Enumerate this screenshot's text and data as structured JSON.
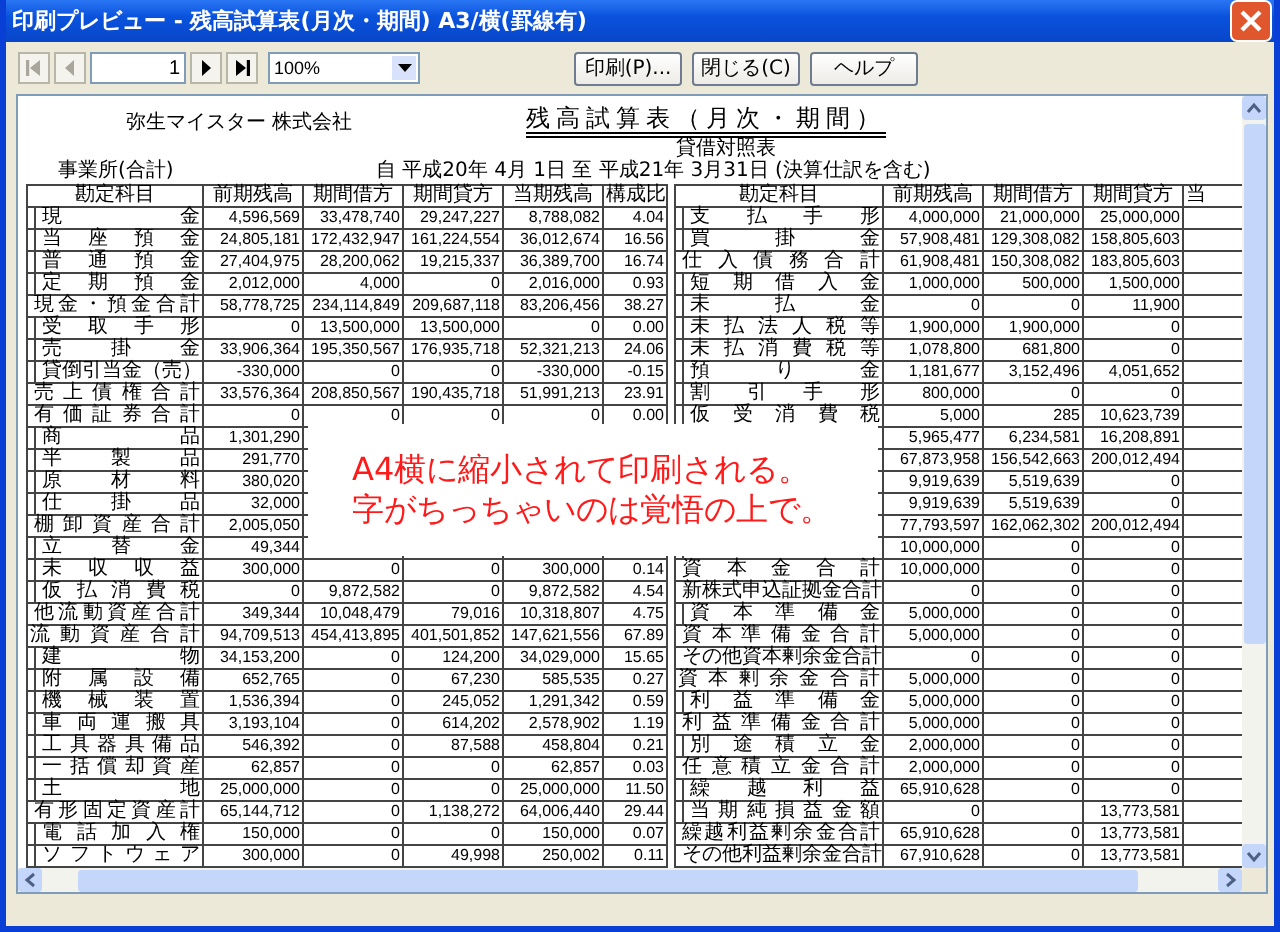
{
  "window": {
    "title": "印刷プレビュー - 残高試算表(月次・期間) A3/横(罫線有)"
  },
  "toolbar": {
    "nav": [
      {
        "kind": "first",
        "disabled": true
      },
      {
        "kind": "prev",
        "disabled": true
      },
      {
        "kind": "next",
        "disabled": false
      },
      {
        "kind": "last",
        "disabled": false
      }
    ],
    "page": "1",
    "zoom": "100%",
    "buttons": [
      "印刷(P)...",
      "閉じる(C)",
      "ヘルプ"
    ]
  },
  "report": {
    "company": "弥生マイスター 株式会社",
    "title": "残高試算表（月次・期間）",
    "statement": "貸借対照表",
    "division": "事業所(合計)",
    "period": "自 平成20年 4月 1日 至 平成21年 3月31日 (決算仕訳を含む)",
    "left_table": {
      "columns": [
        "勘定科目",
        "前期残高",
        "期間借方",
        "期間貸方",
        "当期残高",
        "構成比"
      ],
      "rows": [
        {
          "kind": "item",
          "label": "現金",
          "opening": "4,596,569",
          "debit": "33,478,740",
          "credit": "29,247,227",
          "balance": "8,788,082",
          "ratio": "4.04"
        },
        {
          "kind": "item",
          "label": "当座預金",
          "opening": "24,805,181",
          "debit": "172,432,947",
          "credit": "161,224,554",
          "balance": "36,012,674",
          "ratio": "16.56"
        },
        {
          "kind": "item",
          "label": "普通預金",
          "opening": "27,404,975",
          "debit": "28,200,062",
          "credit": "19,215,337",
          "balance": "36,389,700",
          "ratio": "16.74"
        },
        {
          "kind": "item",
          "label": "定期預金",
          "opening": "2,012,000",
          "debit": "4,000",
          "credit": "0",
          "balance": "2,016,000",
          "ratio": "0.93"
        },
        {
          "kind": "total",
          "label": "現金・預金合計",
          "opening": "58,778,725",
          "debit": "234,114,849",
          "credit": "209,687,118",
          "balance": "83,206,456",
          "ratio": "38.27"
        },
        {
          "kind": "item",
          "label": "受取手形",
          "opening": "0",
          "debit": "13,500,000",
          "credit": "13,500,000",
          "balance": "0",
          "ratio": "0.00"
        },
        {
          "kind": "item",
          "label": "売掛金",
          "opening": "33,906,364",
          "debit": "195,350,567",
          "credit": "176,935,718",
          "balance": "52,321,213",
          "ratio": "24.06"
        },
        {
          "kind": "item",
          "label": "貸倒引当金（売）",
          "opening": "-330,000",
          "debit": "0",
          "credit": "0",
          "balance": "-330,000",
          "ratio": "-0.15"
        },
        {
          "kind": "total",
          "label": "売上債権合計",
          "opening": "33,576,364",
          "debit": "208,850,567",
          "credit": "190,435,718",
          "balance": "51,991,213",
          "ratio": "23.91"
        },
        {
          "kind": "total",
          "label": "有価証券合計",
          "opening": "0",
          "debit": "0",
          "credit": "0",
          "balance": "0",
          "ratio": "0.00"
        },
        {
          "kind": "item",
          "label": "商品",
          "opening": "1,301,290"
        },
        {
          "kind": "item",
          "label": "半製品",
          "opening": "291,770"
        },
        {
          "kind": "item",
          "label": "原材料",
          "opening": "380,020"
        },
        {
          "kind": "item",
          "label": "仕掛品",
          "opening": "32,000"
        },
        {
          "kind": "total",
          "label": "棚卸資産合計",
          "opening": "2,005,050"
        },
        {
          "kind": "item",
          "label": "立替金",
          "opening": "49,344"
        },
        {
          "kind": "item",
          "label": "未収収益",
          "opening": "300,000",
          "debit": "0",
          "credit": "0",
          "balance": "300,000",
          "ratio": "0.14"
        },
        {
          "kind": "item",
          "label": "仮払消費税",
          "opening": "0",
          "debit": "9,872,582",
          "credit": "0",
          "balance": "9,872,582",
          "ratio": "4.54"
        },
        {
          "kind": "total",
          "label": "他流動資産合計",
          "opening": "349,344",
          "debit": "10,048,479",
          "credit": "79,016",
          "balance": "10,318,807",
          "ratio": "4.75"
        },
        {
          "kind": "grand",
          "label": "流動資産合計",
          "opening": "94,709,513",
          "debit": "454,413,895",
          "credit": "401,501,852",
          "balance": "147,621,556",
          "ratio": "67.89"
        },
        {
          "kind": "item",
          "label": "建物",
          "opening": "34,153,200",
          "debit": "0",
          "credit": "124,200",
          "balance": "34,029,000",
          "ratio": "15.65"
        },
        {
          "kind": "item",
          "label": "附属設備",
          "opening": "652,765",
          "debit": "0",
          "credit": "67,230",
          "balance": "585,535",
          "ratio": "0.27"
        },
        {
          "kind": "item",
          "label": "機械装置",
          "opening": "1,536,394",
          "debit": "0",
          "credit": "245,052",
          "balance": "1,291,342",
          "ratio": "0.59"
        },
        {
          "kind": "item",
          "label": "車両運搬具",
          "opening": "3,193,104",
          "debit": "0",
          "credit": "614,202",
          "balance": "2,578,902",
          "ratio": "1.19"
        },
        {
          "kind": "item",
          "label": "工具器具備品",
          "opening": "546,392",
          "debit": "0",
          "credit": "87,588",
          "balance": "458,804",
          "ratio": "0.21"
        },
        {
          "kind": "item",
          "label": "一括償却資産",
          "opening": "62,857",
          "debit": "0",
          "credit": "0",
          "balance": "62,857",
          "ratio": "0.03"
        },
        {
          "kind": "item",
          "label": "土地",
          "opening": "25,000,000",
          "debit": "0",
          "credit": "0",
          "balance": "25,000,000",
          "ratio": "11.50"
        },
        {
          "kind": "total",
          "label": "有形固定資産計",
          "opening": "65,144,712",
          "debit": "0",
          "credit": "1,138,272",
          "balance": "64,006,440",
          "ratio": "29.44"
        },
        {
          "kind": "item",
          "label": "電話加入権",
          "opening": "150,000",
          "debit": "0",
          "credit": "0",
          "balance": "150,000",
          "ratio": "0.07"
        },
        {
          "kind": "item",
          "label": "ソフトウェア",
          "opening": "300,000",
          "debit": "0",
          "credit": "49,998",
          "balance": "250,002",
          "ratio": "0.11"
        }
      ]
    },
    "right_table": {
      "columns": [
        "勘定科目",
        "前期残高",
        "期間借方",
        "期間貸方",
        "当"
      ],
      "rows": [
        {
          "kind": "item",
          "label": "支払手形",
          "opening": "4,000,000",
          "debit": "21,000,000",
          "credit": "25,000,000"
        },
        {
          "kind": "item",
          "label": "買掛金",
          "opening": "57,908,481",
          "debit": "129,308,082",
          "credit": "158,805,603"
        },
        {
          "kind": "total",
          "label": "仕入債務合計",
          "opening": "61,908,481",
          "debit": "150,308,082",
          "credit": "183,805,603"
        },
        {
          "kind": "item",
          "label": "短期借入金",
          "opening": "1,000,000",
          "debit": "500,000",
          "credit": "1,500,000"
        },
        {
          "kind": "item",
          "label": "未払金",
          "opening": "0",
          "debit": "0",
          "credit": "11,900"
        },
        {
          "kind": "item",
          "label": "未払法人税等",
          "opening": "1,900,000",
          "debit": "1,900,000",
          "credit": "0"
        },
        {
          "kind": "item",
          "label": "未払消費税等",
          "opening": "1,078,800",
          "debit": "681,800",
          "credit": "0"
        },
        {
          "kind": "item",
          "label": "預り金",
          "opening": "1,181,677",
          "debit": "3,152,496",
          "credit": "4,051,652"
        },
        {
          "kind": "item",
          "label": "割引手形",
          "opening": "800,000",
          "debit": "0",
          "credit": "0"
        },
        {
          "kind": "item",
          "label": "仮受消費税",
          "opening": "5,000",
          "debit": "285",
          "credit": "10,623,739"
        },
        {
          "kind": "item",
          "opening": "5,965,477",
          "debit": "6,234,581",
          "credit": "16,208,891"
        },
        {
          "kind": "item",
          "opening": "67,873,958",
          "debit": "156,542,663",
          "credit": "200,012,494"
        },
        {
          "kind": "item",
          "opening": "9,919,639",
          "debit": "5,519,639",
          "credit": "0"
        },
        {
          "kind": "item",
          "opening": "9,919,639",
          "debit": "5,519,639",
          "credit": "0"
        },
        {
          "kind": "item",
          "opening": "77,793,597",
          "debit": "162,062,302",
          "credit": "200,012,494"
        },
        {
          "kind": "item",
          "opening": "10,000,000",
          "debit": "0",
          "credit": "0"
        },
        {
          "kind": "total",
          "label": "資本金合計",
          "opening": "10,000,000",
          "debit": "0",
          "credit": "0"
        },
        {
          "kind": "total",
          "label": "新株式申込証拠金合計",
          "opening": "0",
          "debit": "0",
          "credit": "0"
        },
        {
          "kind": "item",
          "label": "資本準備金",
          "opening": "5,000,000",
          "debit": "0",
          "credit": "0"
        },
        {
          "kind": "total",
          "label": "資本準備金合計",
          "opening": "5,000,000",
          "debit": "0",
          "credit": "0"
        },
        {
          "kind": "total",
          "label": "その他資本剰余金合計",
          "opening": "0",
          "debit": "0",
          "credit": "0"
        },
        {
          "kind": "grand",
          "label": "資本剰余金合計",
          "opening": "5,000,000",
          "debit": "0",
          "credit": "0"
        },
        {
          "kind": "item",
          "label": "利益準備金",
          "opening": "5,000,000",
          "debit": "0",
          "credit": "0"
        },
        {
          "kind": "total",
          "label": "利益準備金合計",
          "opening": "5,000,000",
          "debit": "0",
          "credit": "0"
        },
        {
          "kind": "item",
          "label": "別途積立金",
          "opening": "2,000,000",
          "debit": "0",
          "credit": "0"
        },
        {
          "kind": "total",
          "label": "任意積立金合計",
          "opening": "2,000,000",
          "debit": "0",
          "credit": "0"
        },
        {
          "kind": "item",
          "label": "繰越利益",
          "opening": "65,910,628",
          "debit": "0",
          "credit": "0"
        },
        {
          "kind": "item",
          "label": "当期純損益金額",
          "opening": "0",
          "credit": "13,773,581"
        },
        {
          "kind": "total",
          "label": "繰越利益剰余金合計",
          "opening": "65,910,628",
          "debit": "0",
          "credit": "13,773,581"
        },
        {
          "kind": "total",
          "label": "その他利益剰余金合計",
          "opening": "67,910,628",
          "debit": "0",
          "credit": "13,773,581"
        }
      ]
    }
  },
  "note": {
    "lines": [
      "A4横に縮小されて印刷される。",
      "字がちっちゃいのは覚悟の上で。"
    ]
  }
}
